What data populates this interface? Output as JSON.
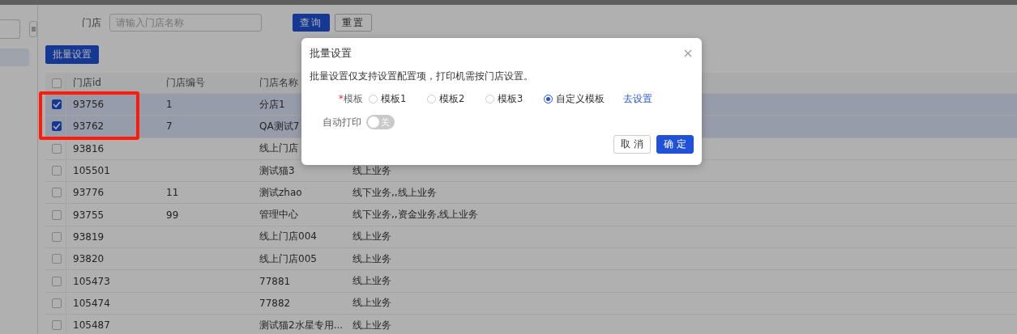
{
  "filter": {
    "label": "门店",
    "placeholder": "请输入门店名称",
    "buttons": [
      {
        "label": "查询",
        "kind": "primary"
      },
      {
        "label": "重置",
        "kind": "default"
      }
    ]
  },
  "batch_button": "批量设置",
  "table": {
    "all_selected": false,
    "columns": [
      "门店id",
      "门店编号",
      "门店名称"
    ],
    "rows": [
      {
        "selected": true,
        "cells": [
          "93756",
          "1",
          "分店1",
          ""
        ]
      },
      {
        "selected": true,
        "cells": [
          "93762",
          "7",
          "QA测试7",
          ""
        ]
      },
      {
        "selected": false,
        "cells": [
          "93816",
          "",
          "线上门店",
          ""
        ]
      },
      {
        "selected": false,
        "cells": [
          "105501",
          "",
          "测试猫3",
          "线上业务"
        ]
      },
      {
        "selected": false,
        "cells": [
          "93776",
          "11",
          "测试zhao",
          "线下业务,,线上业务"
        ]
      },
      {
        "selected": false,
        "cells": [
          "93755",
          "99",
          "管理中心",
          "线下业务,,资金业务,线上业务"
        ]
      },
      {
        "selected": false,
        "cells": [
          "93819",
          "",
          "线上门店004",
          "线上业务"
        ]
      },
      {
        "selected": false,
        "cells": [
          "93820",
          "",
          "线上门店005",
          "线上业务"
        ]
      },
      {
        "selected": false,
        "cells": [
          "105473",
          "",
          "77881",
          "线上业务"
        ]
      },
      {
        "selected": false,
        "cells": [
          "105474",
          "",
          "77882",
          "线上业务"
        ]
      },
      {
        "selected": false,
        "cells": [
          "105487",
          "",
          "测试猫2水星专用...",
          "线上业务"
        ]
      }
    ]
  },
  "modal": {
    "title": "批量设置",
    "note": "批量设置仅支持设置配置项，打印机需按门店设置。",
    "template_label": "模板",
    "required_mark": "*",
    "options": [
      {
        "label": "模板1",
        "selected": false
      },
      {
        "label": "模板2",
        "selected": false
      },
      {
        "label": "模板3",
        "selected": false
      },
      {
        "label": "自定义模板",
        "selected": true
      }
    ],
    "link": "去设置",
    "auto_print": {
      "label": "自动打印",
      "on": false,
      "state_text": "关"
    },
    "buttons": [
      {
        "label": "取 消",
        "kind": "default"
      },
      {
        "label": "确 定",
        "kind": "primary"
      }
    ]
  }
}
